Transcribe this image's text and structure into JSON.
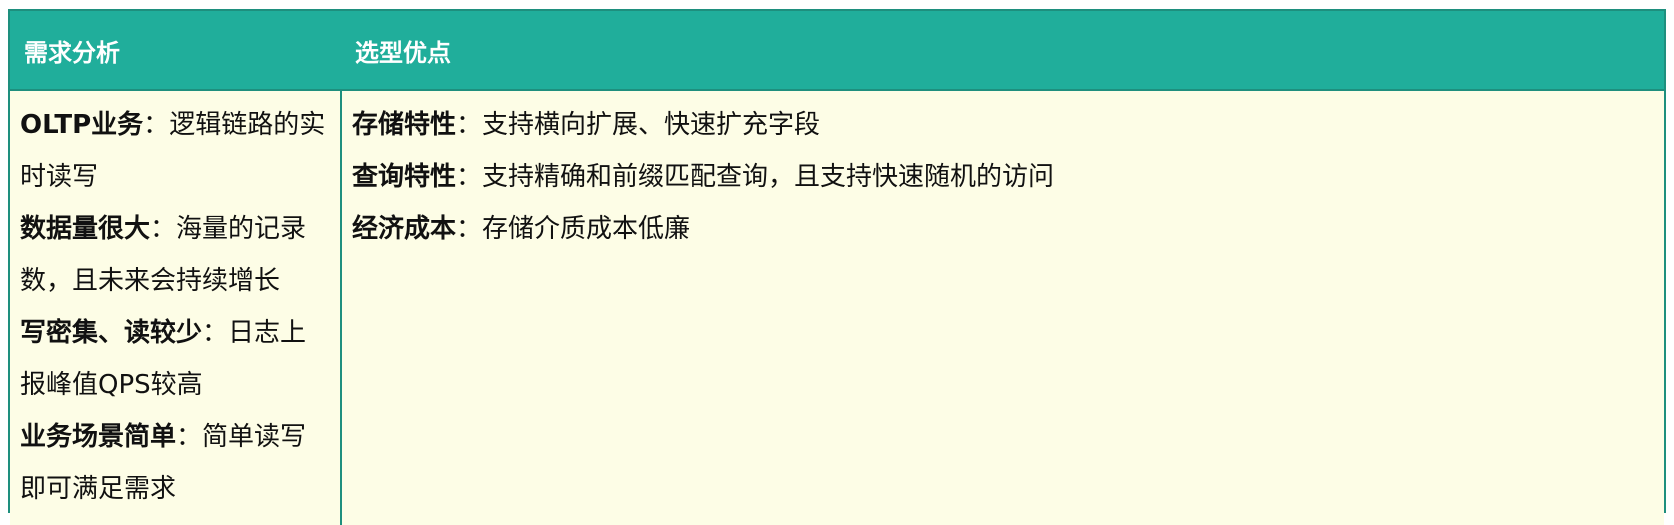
{
  "header": {
    "col1": "需求分析",
    "col2": "选型优点"
  },
  "requirements": [
    {
      "title": "OLTP业务",
      "text": "逻辑链路的实时读写"
    },
    {
      "title": "数据量很大",
      "text": "海量的记录数，且未来会持续增长"
    },
    {
      "title": "写密集、读较少",
      "text": "日志上报峰值QPS较高"
    },
    {
      "title": "业务场景简单",
      "text": "简单读写即可满足需求"
    }
  ],
  "advantages": [
    {
      "title": "存储特性",
      "text": "支持横向扩展、快速扩充字段"
    },
    {
      "title": "查询特性",
      "text": "支持精确和前缀匹配查询，且支持快速随机的访问"
    },
    {
      "title": "经济成本",
      "text": "存储介质成本低廉"
    }
  ],
  "colors": {
    "header_bg": "#20ae9b",
    "border": "#1e8f7e",
    "body_bg": "#fdfde6"
  }
}
